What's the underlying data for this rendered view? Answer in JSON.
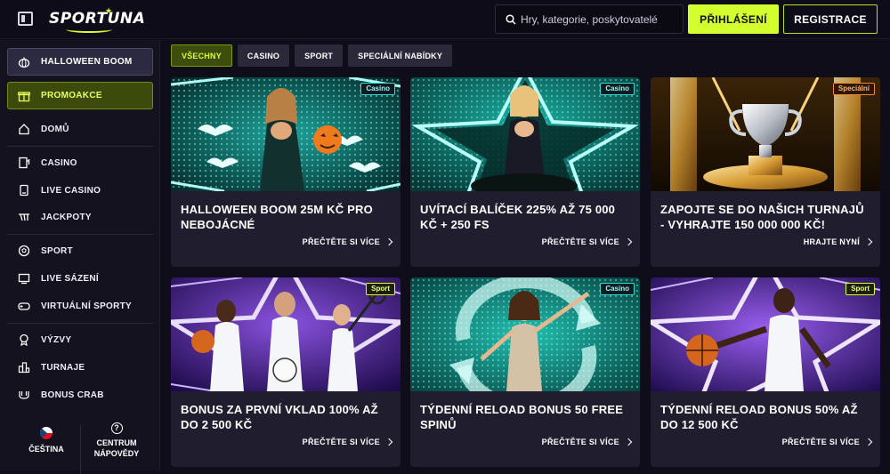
{
  "header": {
    "logo": "SPORTUNA",
    "search_placeholder": "Hry, kategorie, poskytovatelé",
    "login_label": "PŘIHLÁŠENÍ",
    "register_label": "REGISTRACE"
  },
  "sidebar": {
    "highlights": [
      {
        "label": "HALLOWEEN BOOM",
        "icon": "pumpkin-icon"
      },
      {
        "label": "PROMOAKCE",
        "icon": "gift-icon"
      }
    ],
    "items": [
      {
        "label": "DOMŮ",
        "icon": "home-icon"
      },
      {
        "label": "CASINO",
        "icon": "casino-icon"
      },
      {
        "label": "LIVE CASINO",
        "icon": "live-casino-icon"
      },
      {
        "label": "JACKPOTY",
        "icon": "jackpot-icon"
      },
      {
        "label": "SPORT",
        "icon": "soccer-ball-icon"
      },
      {
        "label": "LIVE SÁZENÍ",
        "icon": "live-betting-icon"
      },
      {
        "label": "VIRTUÁLNÍ SPORTY",
        "icon": "gamepad-icon"
      },
      {
        "label": "VÝZVY",
        "icon": "medal-icon"
      },
      {
        "label": "TURNAJE",
        "icon": "tournament-icon"
      },
      {
        "label": "BONUS CRAB",
        "icon": "crab-icon"
      }
    ],
    "language": "ČEŠTINA",
    "help_line1": "CENTRUM",
    "help_line2": "NÁPOVĚDY"
  },
  "filters": [
    "VŠECHNY",
    "CASINO",
    "SPORT",
    "SPECIÁLNÍ NABÍDKY"
  ],
  "cards": [
    {
      "badge": "Casino",
      "title": "HALLOWEEN BOOM 25M KČ PRO NEBOJÁCNÉ",
      "link": "PŘEČTĚTE SI VÍCE"
    },
    {
      "badge": "Casino",
      "title": "UVÍTACÍ BALÍČEK 225% AŽ 75 000 KČ + 250 FS",
      "link": "PŘEČTĚTE SI VÍCE"
    },
    {
      "badge": "Speciální",
      "title": "ZAPOJTE SE DO NAŠICH TURNAJŮ - VYHRAJTE 150 000 000 KČ!",
      "link": "HRAJTE NYNÍ"
    },
    {
      "badge": "Sport",
      "title": "BONUS ZA PRVNÍ VKLAD 100% AŽ DO 2 500 KČ",
      "link": "PŘEČTĚTE SI VÍCE"
    },
    {
      "badge": "Casino",
      "title": "TÝDENNÍ RELOAD BONUS 50 FREE SPINŮ",
      "link": "PŘEČTĚTE SI VÍCE"
    },
    {
      "badge": "Sport",
      "title": "TÝDENNÍ RELOAD BONUS 50% AŽ DO 12 500 KČ",
      "link": "PŘEČTĚTE SI VÍCE"
    }
  ],
  "colors": {
    "accent": "#d4ff2e",
    "casino_badge": "#38d7d0",
    "special_badge": "#f08a2c",
    "bg": "#0f0d1a"
  }
}
